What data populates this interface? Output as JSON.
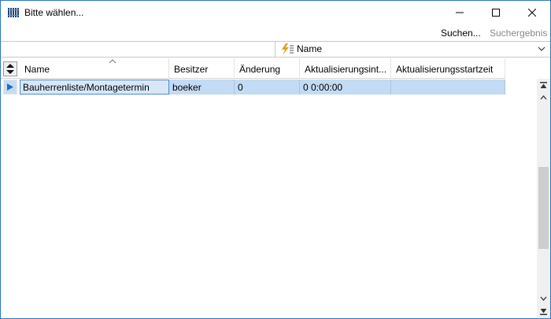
{
  "window": {
    "title": "Bitte wählen...",
    "icon": "library-books-icon",
    "controls": [
      "minimize-icon",
      "maximize-icon",
      "close-icon"
    ]
  },
  "toolbar": {
    "search_label": "Suchen...",
    "result_label": "Suchergebnis"
  },
  "sort": {
    "selected": "Name",
    "icon": "lightning-sort-icon"
  },
  "grid": {
    "columns": [
      {
        "label": "Name",
        "sorted": "ascending"
      },
      {
        "label": "Besitzer"
      },
      {
        "label": "Änderung"
      },
      {
        "label": "Aktualisierungsint..."
      },
      {
        "label": "Aktualisierungsstartzeit"
      }
    ],
    "rows": [
      {
        "selected": true,
        "cells": [
          "Bauherrenliste/Montagetermin",
          "boeker",
          "0",
          "0 0:00:00",
          ""
        ]
      }
    ]
  },
  "colors": {
    "window_border": "#2b79c2",
    "selection": "#c3dbf4",
    "active_cell_border": "#4f8ad0",
    "row_indicator_arrow": "#1b6fc7",
    "disabled_text": "#8a8a8a"
  }
}
